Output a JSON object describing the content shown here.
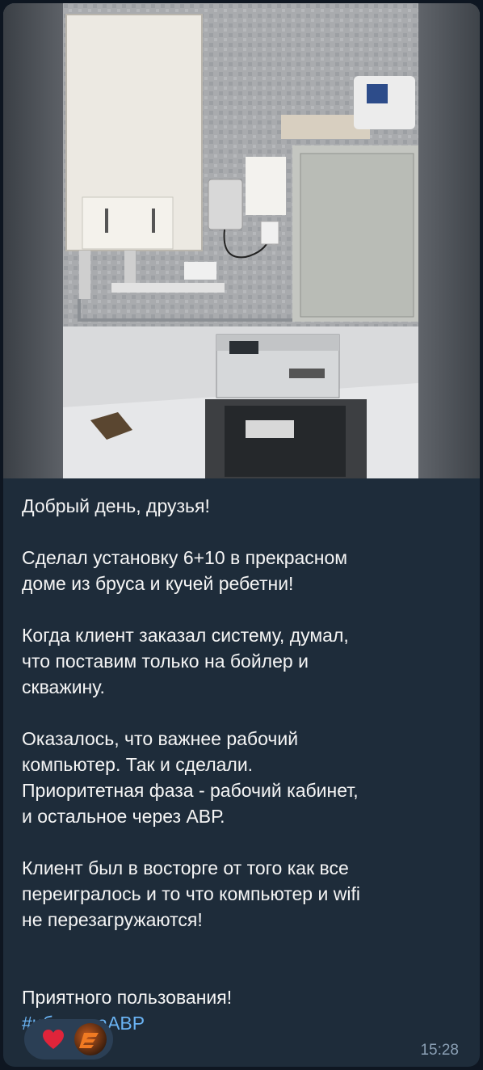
{
  "message": {
    "paragraphs": [
      "Добрый день, друзья!",
      "Сделал установку 6+10 в прекрасном\nдоме из бруса и кучей ребетни!",
      "Когда клиент заказал систему, думал,\nчто поставим только на бойлер и\nскважину.",
      "Оказалось, что важнее рабочий\nкомпьютер. Так и сделали.\nПриоритетная фаза - рабочий кабинет,\nи остальное через АВР.",
      "Клиент был в восторге от того как все\nпереигралось и то что компьютер и wifi\nне перезагружаются!"
    ],
    "closing": "Приятного пользования!",
    "hashtag": "#ибпдомаАВР",
    "time": "15:28"
  },
  "reactions": [
    {
      "icon": "heart-icon",
      "color": "#e0243a"
    },
    {
      "icon": "avatar",
      "color": "#c45a1e"
    }
  ],
  "colors": {
    "background": "#0e1621",
    "bubble": "#1e2c3a",
    "link": "#6ab3f3",
    "text": "#f5f5f5",
    "time": "#8ba0b5"
  }
}
